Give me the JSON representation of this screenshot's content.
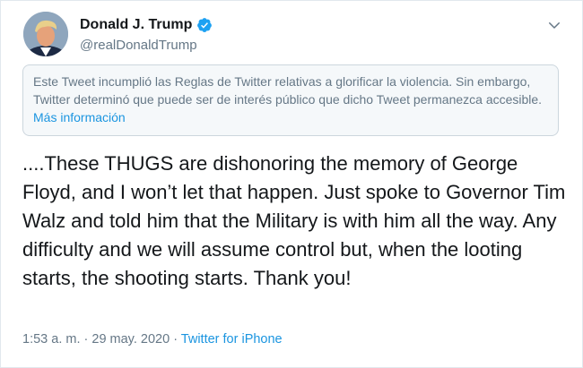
{
  "author": {
    "display_name": "Donald J. Trump",
    "handle": "@realDonaldTrump",
    "verified": true,
    "avatar_icon": "profile-photo"
  },
  "notice": {
    "text": "Este Tweet incumplió las Reglas de Twitter relativas a glorificar la violencia. Sin embargo, Twitter determinó que puede ser de interés público que dicho Tweet permanezca accesible. ",
    "link_label": "Más información"
  },
  "tweet": {
    "text": "....These THUGS are dishonoring the memory of George Floyd, and I won’t let that happen. Just spoke to Governor Tim Walz and told him that the Military is with him all the way. Any difficulty and we will assume control but, when the looting starts, the shooting starts. Thank you!"
  },
  "meta": {
    "time": "1:53 a. m.",
    "separator": " · ",
    "date": "29 may. 2020",
    "source": "Twitter for iPhone"
  },
  "colors": {
    "link": "#1b95e0",
    "verified_badge": "#1da1f2",
    "text": "#14171a",
    "muted": "#657786"
  }
}
